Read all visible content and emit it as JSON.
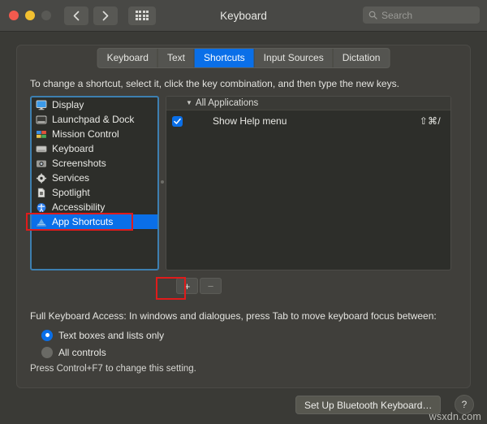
{
  "window": {
    "title": "Keyboard",
    "traffic_lights": [
      "close",
      "minimize",
      "zoom"
    ],
    "back_label": "Back",
    "forward_label": "Forward",
    "show_all_label": "Show All"
  },
  "search": {
    "placeholder": "Search",
    "value": "",
    "icon": "search-icon"
  },
  "tabs": [
    {
      "label": "Keyboard",
      "active": false
    },
    {
      "label": "Text",
      "active": false
    },
    {
      "label": "Shortcuts",
      "active": true
    },
    {
      "label": "Input Sources",
      "active": false
    },
    {
      "label": "Dictation",
      "active": false
    }
  ],
  "instructions": "To change a shortcut, select it, click the key combination, and then type the new keys.",
  "sidebar": {
    "items": [
      {
        "label": "Display",
        "icon": "display-icon",
        "selected": false
      },
      {
        "label": "Launchpad & Dock",
        "icon": "launchpad-dock-icon",
        "selected": false
      },
      {
        "label": "Mission Control",
        "icon": "mission-control-icon",
        "selected": false
      },
      {
        "label": "Keyboard",
        "icon": "keyboard-icon",
        "selected": false
      },
      {
        "label": "Screenshots",
        "icon": "screenshots-icon",
        "selected": false
      },
      {
        "label": "Services",
        "icon": "services-gear-icon",
        "selected": false
      },
      {
        "label": "Spotlight",
        "icon": "spotlight-icon",
        "selected": false
      },
      {
        "label": "Accessibility",
        "icon": "accessibility-icon",
        "selected": false
      },
      {
        "label": "App Shortcuts",
        "icon": "app-shortcuts-icon",
        "selected": true
      }
    ]
  },
  "shortcut_list": {
    "group_label": "All Applications",
    "disclosure": "▼",
    "rows": [
      {
        "checked": true,
        "name": "Show Help menu",
        "keys": "⇧⌘/"
      }
    ]
  },
  "list_buttons": {
    "add_label": "+",
    "remove_label": "−"
  },
  "full_keyboard_access": {
    "description": "Full Keyboard Access: In windows and dialogues, press Tab to move keyboard focus between:",
    "options": [
      {
        "label": "Text boxes and lists only",
        "selected": true
      },
      {
        "label": "All controls",
        "selected": false
      }
    ],
    "hint": "Press Control+F7 to change this setting."
  },
  "footer": {
    "bluetooth_button": "Set Up Bluetooth Keyboard…",
    "help_button": "?"
  },
  "watermark": "wsxdn.com",
  "colors": {
    "accent_blue": "#0a6fe8",
    "annotation_red": "#e01b1b",
    "window_bg": "#3a3a36",
    "panel_bg": "#403f3b",
    "list_bg": "#2d2e2a",
    "focus_border": "#3d7fb0"
  }
}
